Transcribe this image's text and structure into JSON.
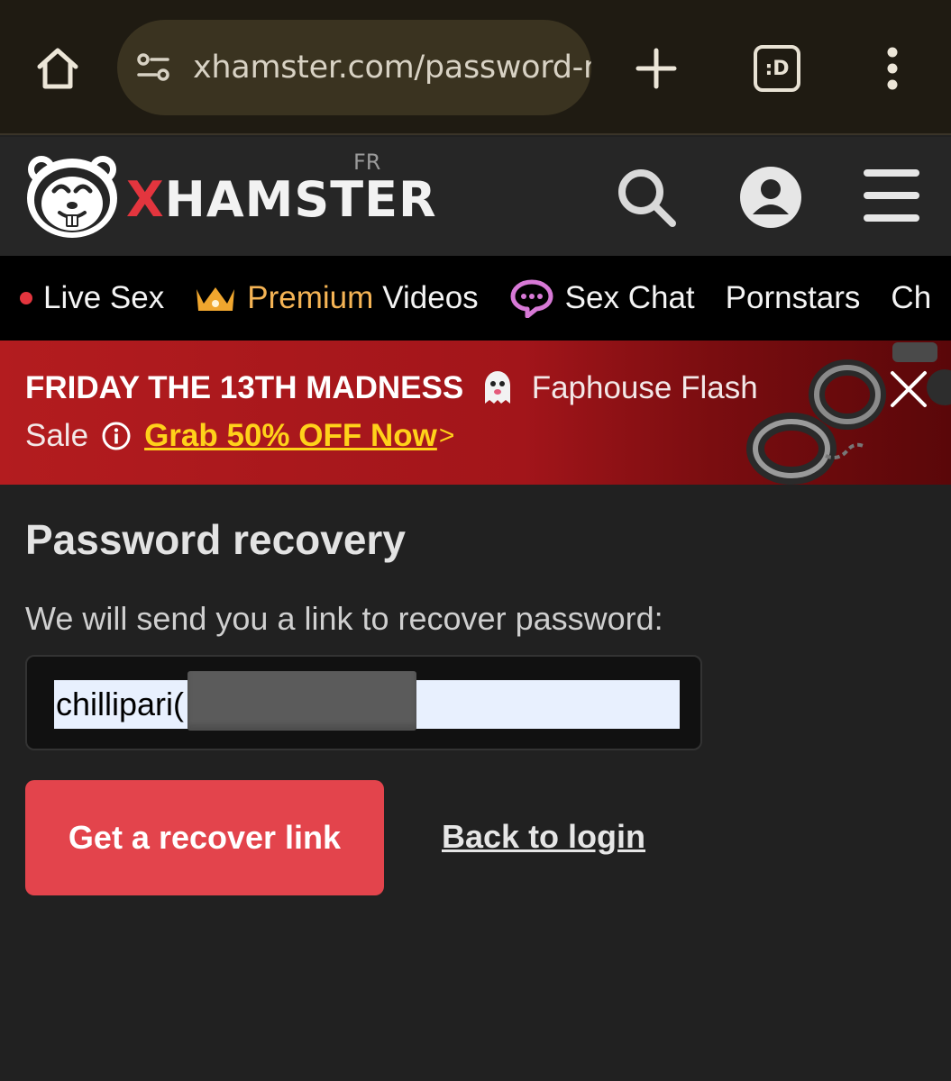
{
  "browser": {
    "url": "xhamster.com/password-r",
    "tabs_label": ":D"
  },
  "header": {
    "logo_x": "X",
    "logo_rest": "HAMSTER",
    "region": "FR"
  },
  "nav": {
    "items": [
      {
        "label": "Live Sex"
      },
      {
        "prefix": "Premium",
        "label": "Videos"
      },
      {
        "label": "Sex Chat"
      },
      {
        "label": "Pornstars"
      },
      {
        "label": "Ch"
      }
    ]
  },
  "promo": {
    "headline": "FRIDAY THE 13TH MADNESS",
    "brand_text": "Faphouse Flash",
    "sale_text": "Sale",
    "cta": "Grab 50% OFF Now",
    "cta_arrow": ">"
  },
  "main": {
    "title": "Password recovery",
    "description": "We will send you a link to recover password:",
    "email_value": "chillipari(",
    "submit_label": "Get a recover link",
    "back_label": "Back to login"
  },
  "colors": {
    "brand_red": "#e3353e",
    "button_red": "#e3444c",
    "promo_red": "#b31c1f",
    "cta_yellow": "#ffd21a",
    "premium_gold": "#f5b455"
  }
}
